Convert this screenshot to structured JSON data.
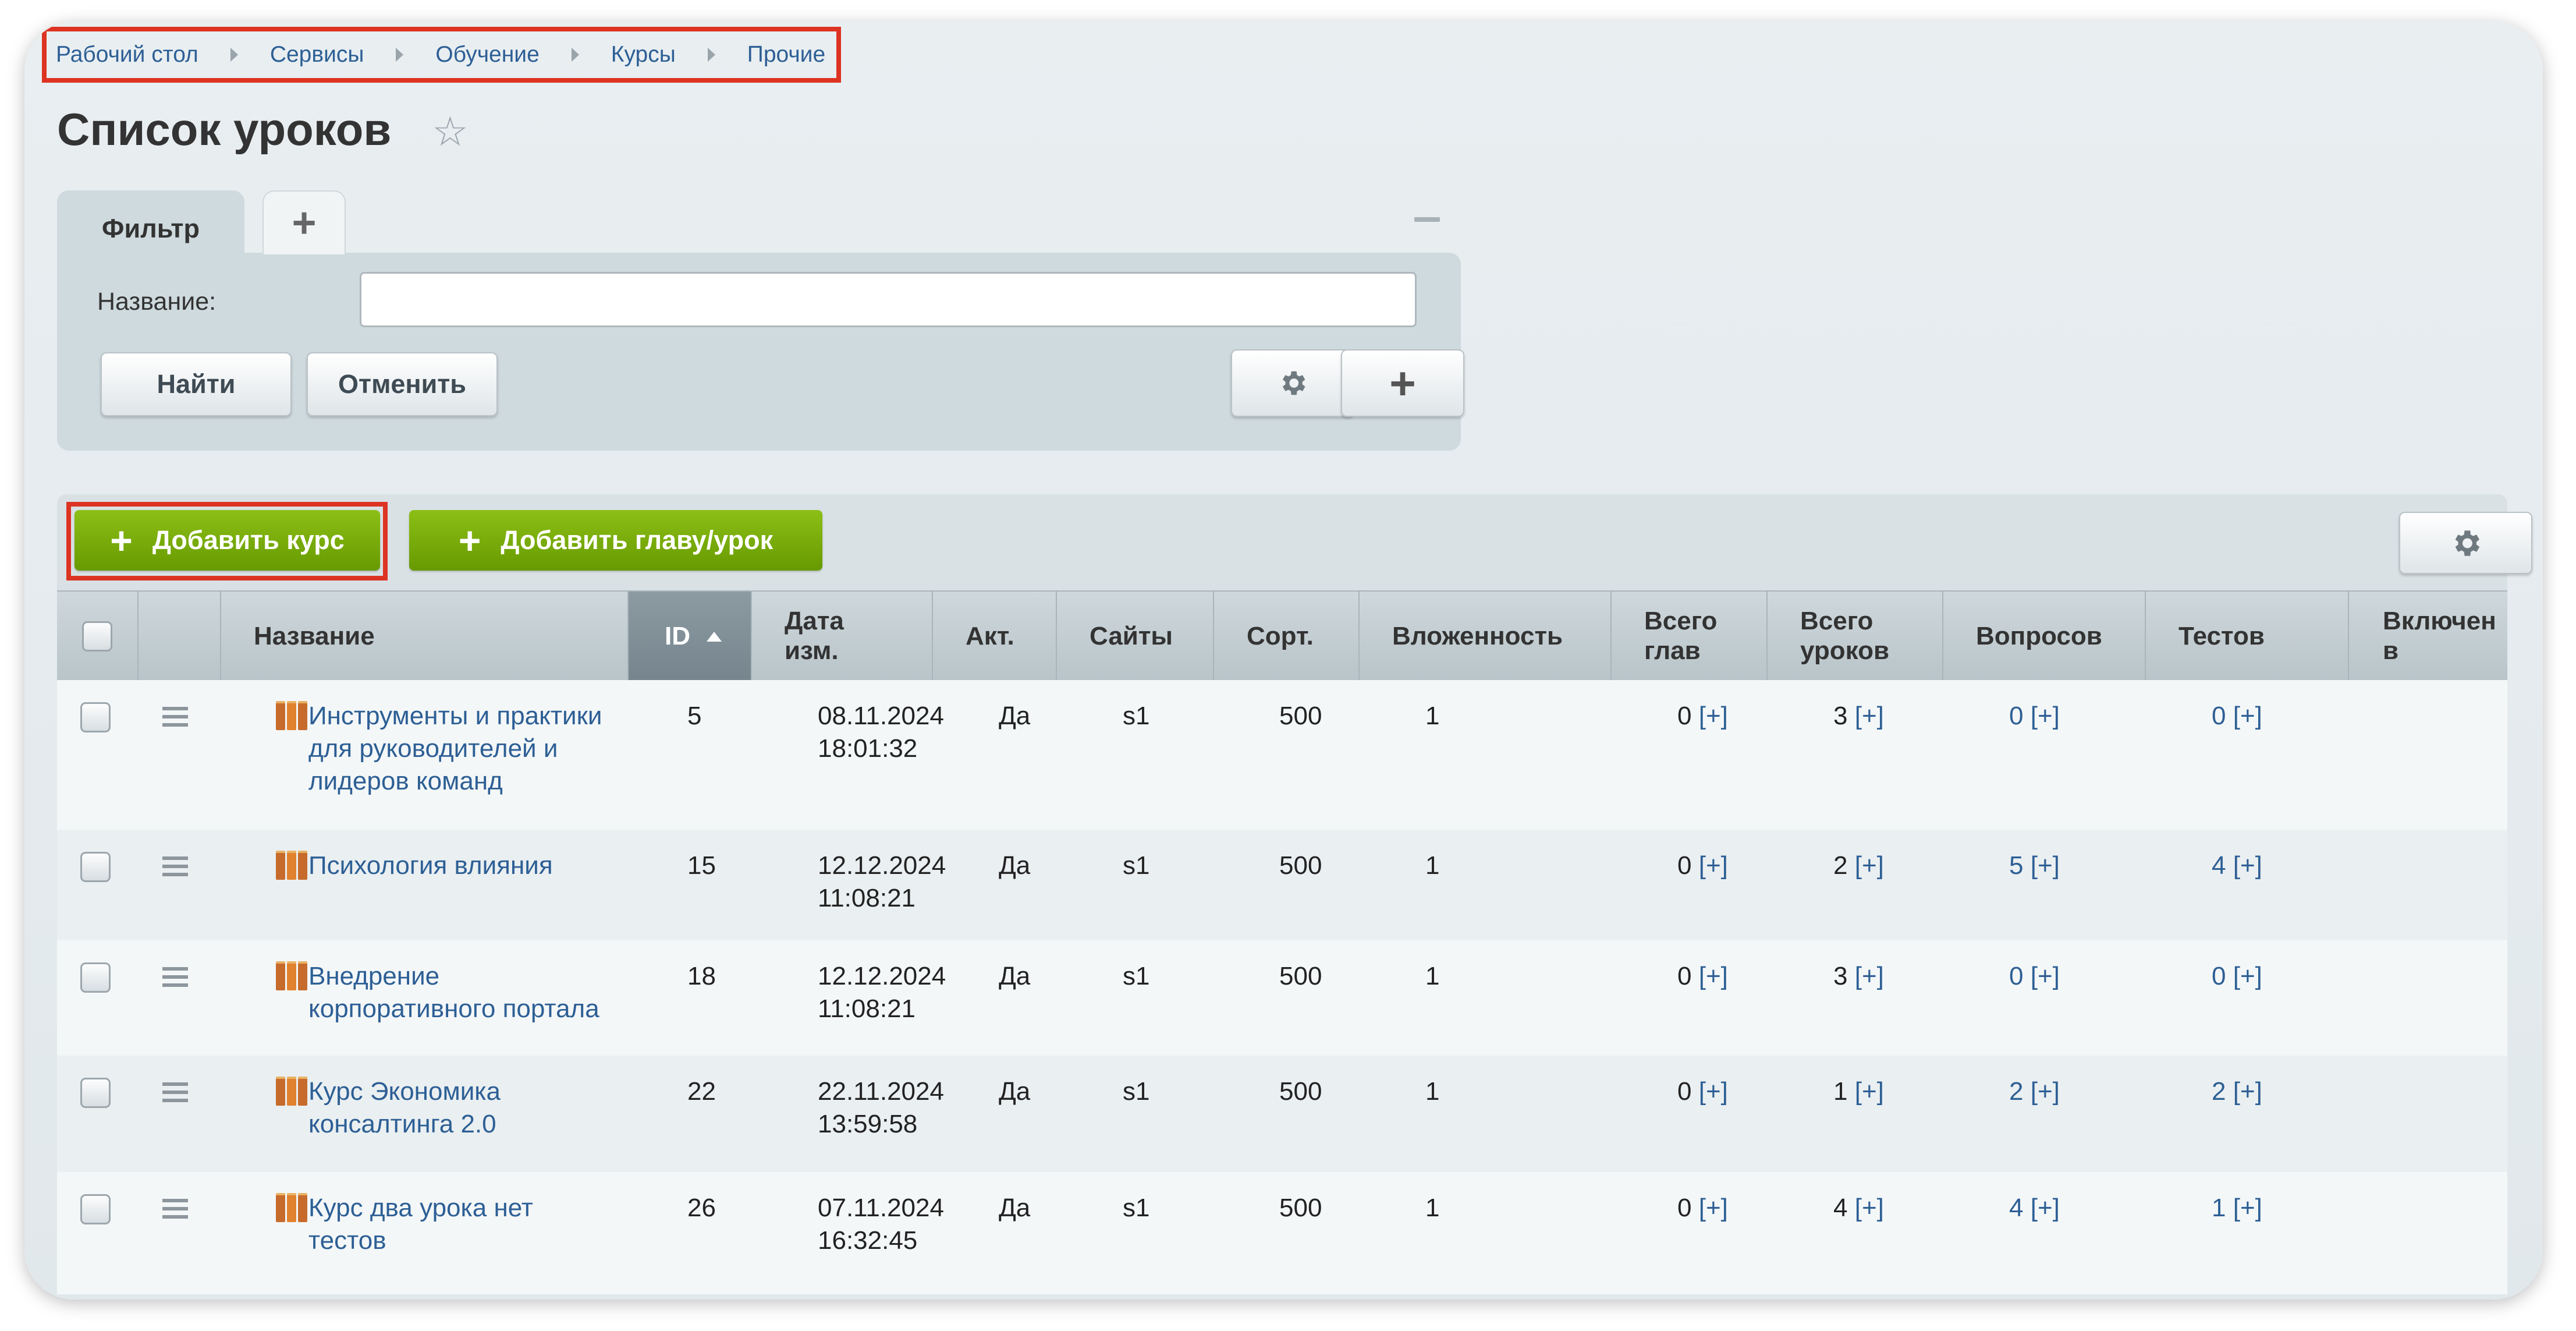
{
  "breadcrumb": [
    "Рабочий стол",
    "Сервисы",
    "Обучение",
    "Курсы",
    "Прочие"
  ],
  "page_title": "Список уроков",
  "filter": {
    "tab_label": "Фильтр",
    "field_label": "Название:",
    "field_value": "",
    "find_button": "Найти",
    "cancel_button": "Отменить"
  },
  "toolbar": {
    "add_course": "Добавить курс",
    "add_chapter": "Добавить главу/урок"
  },
  "table": {
    "headers": {
      "name": "Название",
      "id": "ID",
      "date": "Дата изм.",
      "active": "Акт.",
      "sites": "Сайты",
      "sort": "Сорт.",
      "nesting": "Вложенность",
      "chapters": "Всего глав",
      "lessons": "Всего уроков",
      "questions": "Вопросов",
      "tests": "Тестов",
      "included": "Включен в"
    },
    "plus_label": "[+]",
    "rows": [
      {
        "name_lines": [
          "Инструменты и практики",
          "для руководителей и",
          "лидеров команд"
        ],
        "id": "5",
        "date": "08.11.2024",
        "time": "18:01:32",
        "active": "Да",
        "site": "s1",
        "sort": "500",
        "nesting": "1",
        "chapters": "0",
        "lessons": "3",
        "questions": "0",
        "tests": "0"
      },
      {
        "name_lines": [
          "Психология влияния"
        ],
        "id": "15",
        "date": "12.12.2024",
        "time": "11:08:21",
        "active": "Да",
        "site": "s1",
        "sort": "500",
        "nesting": "1",
        "chapters": "0",
        "lessons": "2",
        "questions": "5",
        "tests": "4"
      },
      {
        "name_lines": [
          "Внедрение",
          "корпоративного портала"
        ],
        "id": "18",
        "date": "12.12.2024",
        "time": "11:08:21",
        "active": "Да",
        "site": "s1",
        "sort": "500",
        "nesting": "1",
        "chapters": "0",
        "lessons": "3",
        "questions": "0",
        "tests": "0"
      },
      {
        "name_lines": [
          "Курс Экономика",
          "консалтинга 2.0"
        ],
        "id": "22",
        "date": "22.11.2024",
        "time": "13:59:58",
        "active": "Да",
        "site": "s1",
        "sort": "500",
        "nesting": "1",
        "chapters": "0",
        "lessons": "1",
        "questions": "2",
        "tests": "2"
      },
      {
        "name_lines": [
          "Курс два урока нет",
          "тестов"
        ],
        "id": "26",
        "date": "07.11.2024",
        "time": "16:32:45",
        "active": "Да",
        "site": "s1",
        "sort": "500",
        "nesting": "1",
        "chapters": "0",
        "lessons": "4",
        "questions": "4",
        "tests": "1"
      }
    ]
  }
}
